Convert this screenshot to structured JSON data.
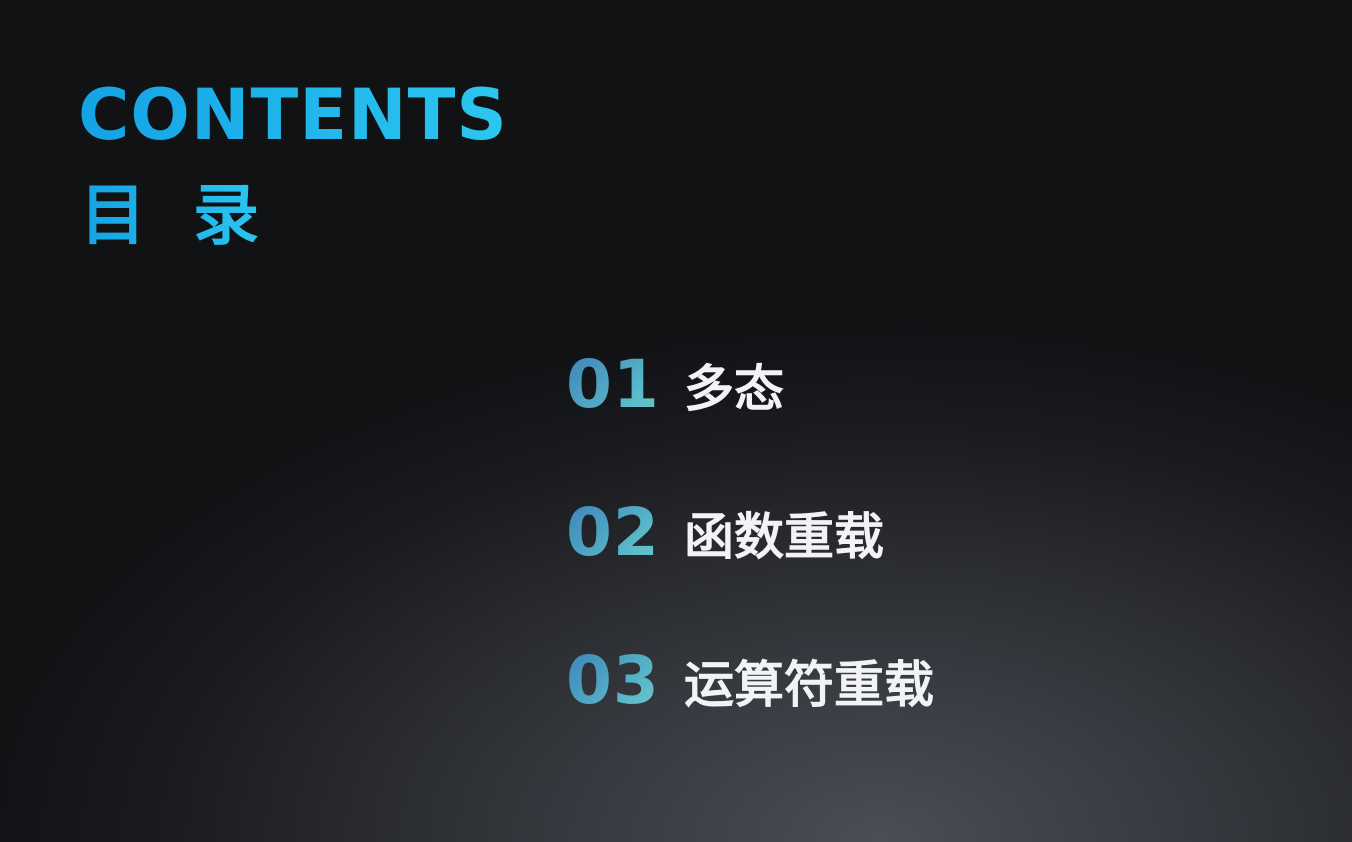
{
  "heading": {
    "title_en": "CONTENTS",
    "title_cn": "目 录"
  },
  "toc": {
    "items": [
      {
        "number": "01",
        "label": "多态"
      },
      {
        "number": "02",
        "label": "函数重载"
      },
      {
        "number": "03",
        "label": "运算符重载"
      }
    ]
  },
  "colors": {
    "heading_accent": "#1fb2ec",
    "number_gradient_start": "#3d7fb7",
    "number_gradient_end": "#75d1c5",
    "label_text": "#f2f3f5",
    "background_dark": "#111214",
    "background_light": "#4a4e55"
  }
}
